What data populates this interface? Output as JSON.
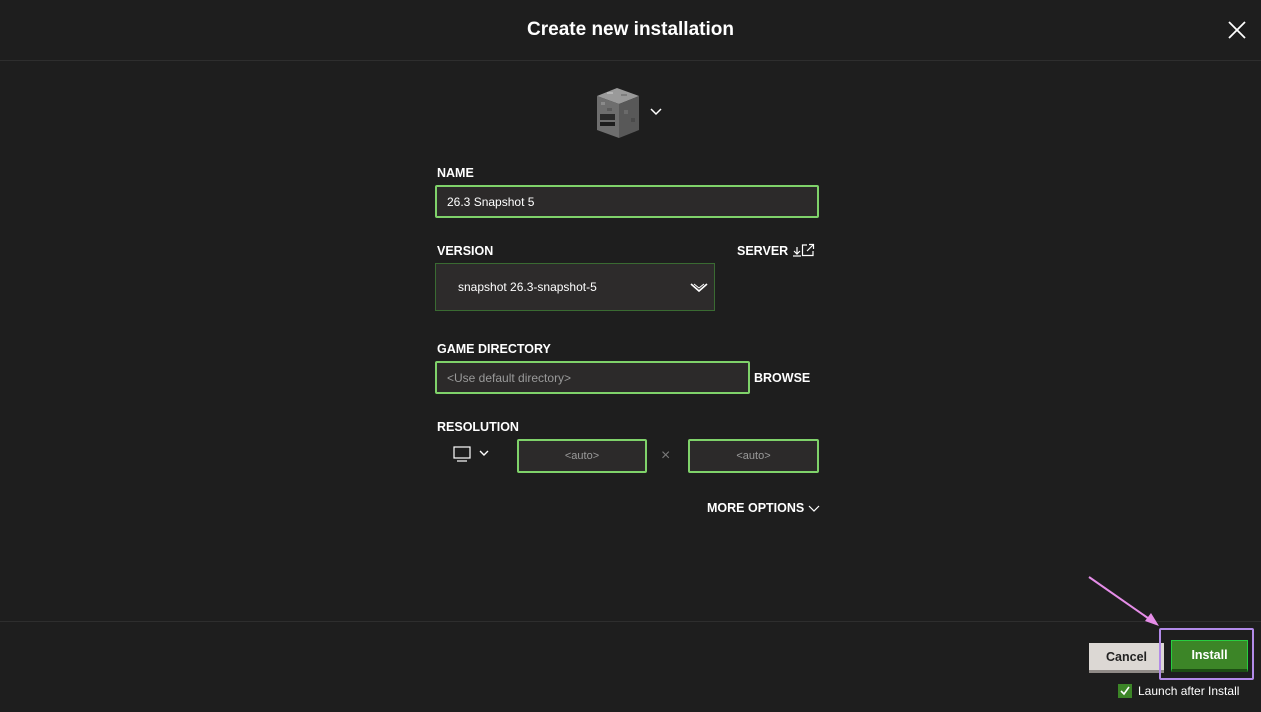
{
  "dialog": {
    "title": "Create new installation",
    "close_icon": "close-icon"
  },
  "icon_picker": {
    "icon": "furnace-block-icon",
    "chevron": "chevron-down-icon"
  },
  "name": {
    "label": "NAME",
    "value": "26.3 Snapshot 5"
  },
  "version": {
    "label": "VERSION",
    "selected": "snapshot 26.3-snapshot-5",
    "server_label": "SERVER"
  },
  "game_directory": {
    "label": "GAME DIRECTORY",
    "placeholder": "<Use default directory>",
    "browse_label": "BROWSE"
  },
  "resolution": {
    "label": "RESOLUTION",
    "width_placeholder": "<auto>",
    "height_placeholder": "<auto>",
    "separator": "×"
  },
  "more_options": {
    "label": "MORE OPTIONS"
  },
  "footer": {
    "cancel_label": "Cancel",
    "install_label": "Install",
    "launch_after_install_label": "Launch after Install",
    "launch_after_install_checked": true
  },
  "colors": {
    "background": "#1e1e1e",
    "field_border": "#7fd26a",
    "install_green": "#3c8527",
    "highlight_purple": "#b28ae8",
    "annotation_arrow": "#e58de8"
  }
}
